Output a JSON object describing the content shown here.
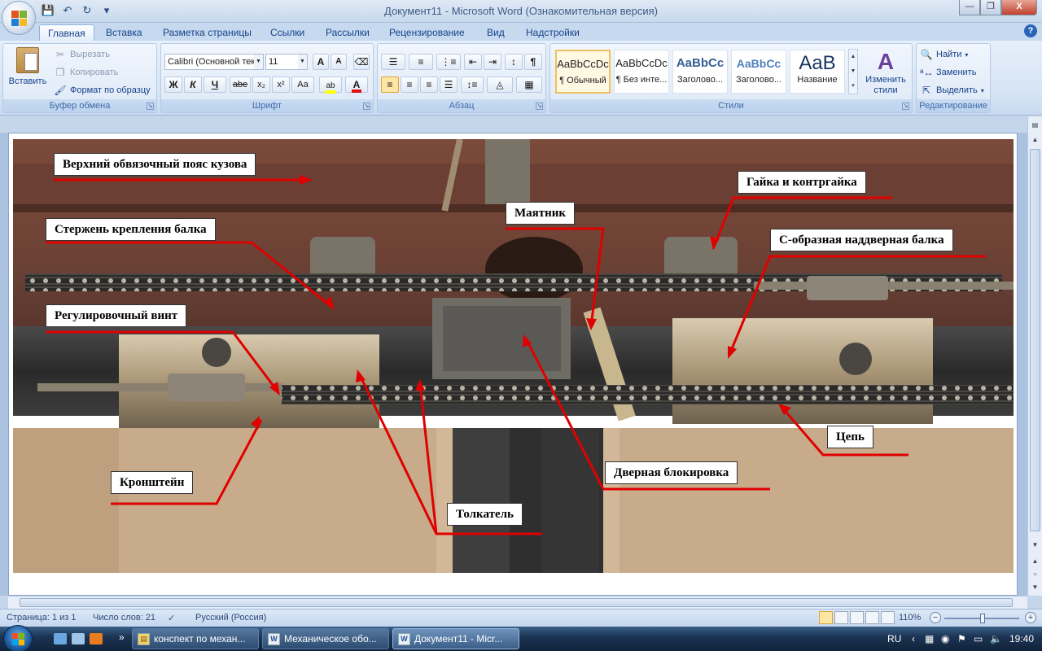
{
  "window": {
    "title": "Документ11 - Microsoft Word (Ознакомительная версия)",
    "buttons": {
      "minimize": "—",
      "maximize": "❐",
      "close": "X"
    }
  },
  "tabs": [
    "Главная",
    "Вставка",
    "Разметка страницы",
    "Ссылки",
    "Рассылки",
    "Рецензирование",
    "Вид",
    "Надстройки"
  ],
  "ribbon": {
    "clipboard": {
      "paste": "Вставить",
      "cut": "Вырезать",
      "copy": "Копировать",
      "format_painter": "Формат по образцу",
      "label": "Буфер обмена"
    },
    "font": {
      "name": "Calibri (Основной текст)",
      "size": "11",
      "grow": "A",
      "shrink": "A",
      "bold": "Ж",
      "italic": "К",
      "underline": "Ч",
      "strike": "abe",
      "subscript": "x₂",
      "superscript": "x²",
      "case": "Aa",
      "label": "Шрифт"
    },
    "paragraph": {
      "label": "Абзац"
    },
    "styles": {
      "items": [
        {
          "sample": "AaBbCcDc",
          "name": "¶ Обычный"
        },
        {
          "sample": "AaBbCcDc",
          "name": "¶ Без инте..."
        },
        {
          "sample": "AaBbCc",
          "name": "Заголово..."
        },
        {
          "sample": "AaBbCc",
          "name": "Заголово..."
        },
        {
          "sample": "AaB",
          "name": "Название"
        }
      ],
      "change": "Изменить стили",
      "label": "Стили"
    },
    "editing": {
      "find": "Найти",
      "replace": "Заменить",
      "select": "Выделить",
      "label": "Редактирование"
    }
  },
  "figure_labels": {
    "top_belt": "Верхний обвязочный пояс кузова",
    "nut": "Гайка и контргайка",
    "pendulum": "Маятник",
    "rod": "Стержень крепления балка",
    "c_beam": "С-образная наддверная балка",
    "adj_screw": "Регулировочный винт",
    "chain": "Цепь",
    "bracket": "Кронштейн",
    "door_lock": "Дверная блокировка",
    "pusher": "Толкатель"
  },
  "statusbar": {
    "page": "Страница: 1 из 1",
    "words": "Число слов: 21",
    "language": "Русский (Россия)",
    "zoom": "110%"
  },
  "taskbar": {
    "tasks": [
      "конспект по механ...",
      "Механическое обо...",
      "Документ11 - Micr..."
    ],
    "lang": "RU",
    "time": "19:40"
  }
}
